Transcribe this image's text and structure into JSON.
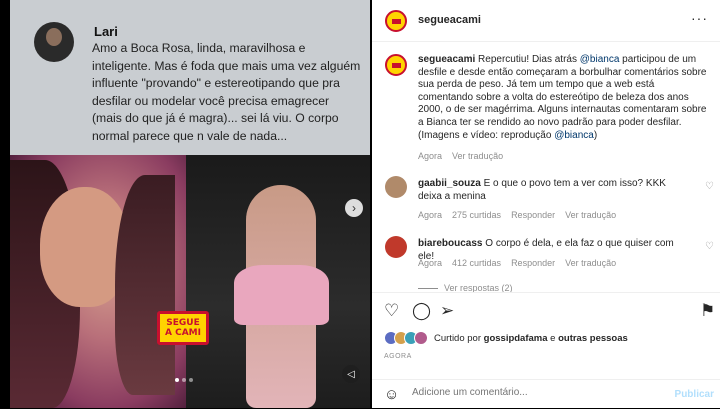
{
  "tweet": {
    "name": "Lari",
    "text": "Amo a Boca Rosa, linda, maravilhosa e inteligente. Mas é foda que mais uma vez alguém influente \"provando\" e estereotipando que pra desfilar ou modelar você precisa emagrecer (mais do que já é magra)... sei lá viu. O corpo normal parece que n vale de nada..."
  },
  "media_logo": {
    "line1": "SEGUE",
    "line2": "A CAMI"
  },
  "header": {
    "username": "segueacami",
    "more": "···"
  },
  "caption": {
    "username": "segueacami",
    "text1": "Repercutiu! Dias atrás ",
    "mention1": "@bianca",
    "text2": " participou de um desfile e desde então começaram a borbulhar comentários sobre sua perda de peso. Já tem um tempo que a web está comentando sobre a volta do estereótipo de beleza dos anos 2000, o de ser magérrima. Alguns internautas comentaram sobre a Bianca ter se rendido ao novo padrão para poder desfilar. (Imagens e vídeo: reprodução ",
    "mention2": "@bianca",
    "text3": ")",
    "time": "Agora",
    "translate": "Ver tradução"
  },
  "comments": [
    {
      "username": "gaabii_souza",
      "text": "E o que o povo tem a ver com isso? KKK deixa a menina",
      "time": "Agora",
      "likes": "275 curtidas",
      "reply": "Responder",
      "translate": "Ver tradução",
      "avatar_color": "#b08a6a"
    },
    {
      "username": "biareboucass",
      "text": "O corpo é dela, e ela faz o que quiser com ele!",
      "time": "Agora",
      "likes": "412 curtidas",
      "reply": "Responder",
      "translate": "Ver tradução",
      "avatar_color": "#c0392b"
    }
  ],
  "replies_label": "Ver respostas (2)",
  "likes": {
    "prefix": "Curtido por ",
    "user": "gossipdafama",
    "mid": " e ",
    "others": "outras pessoas"
  },
  "when": "AGORA",
  "add_comment": {
    "placeholder": "Adicione um comentário...",
    "publish": "Publicar"
  },
  "colors": {
    "accent": "#0095f6",
    "logo_yellow": "#ffd400",
    "logo_red": "#c8102e"
  }
}
